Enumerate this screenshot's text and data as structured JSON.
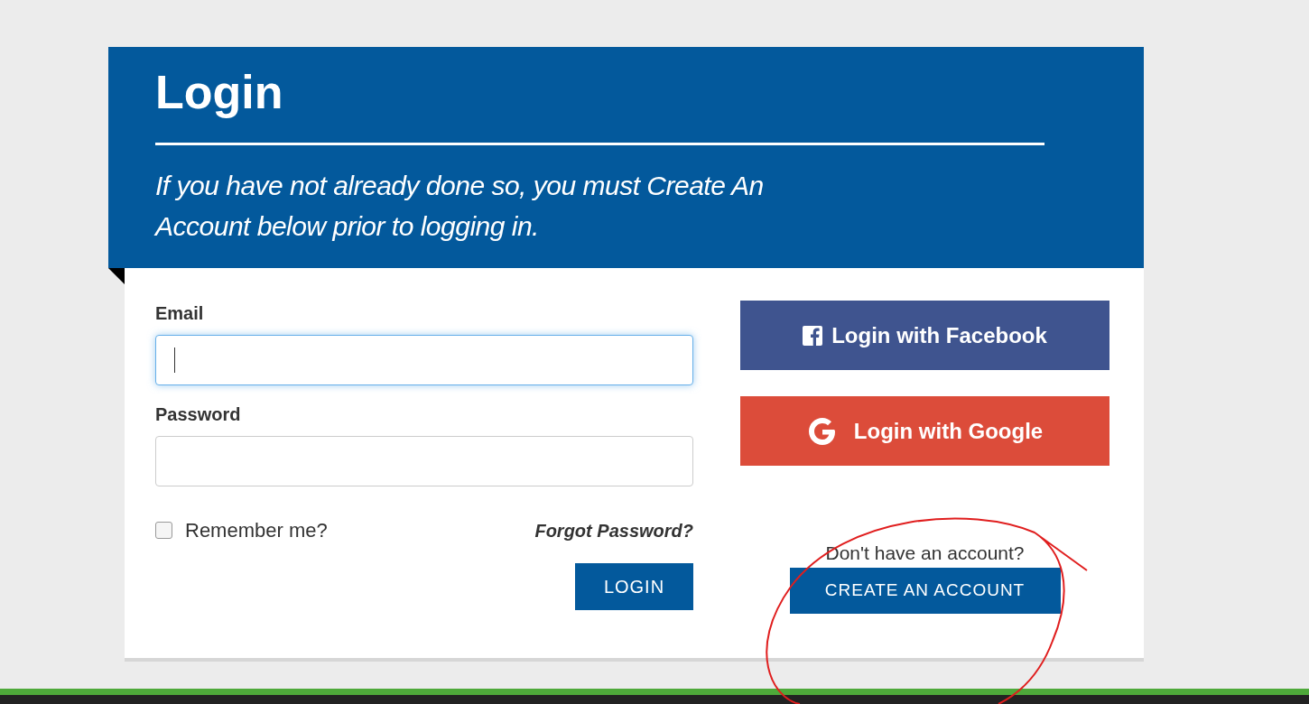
{
  "header": {
    "title": "Login",
    "subtitle": "If you have not already done so, you must Create An Account below prior to logging in."
  },
  "fields": [
    {
      "label": "Email",
      "focused": true
    },
    {
      "label": "Password",
      "focused": false
    }
  ],
  "remember": {
    "label": "Remember me?",
    "checked": false
  },
  "forgot_link": "Forgot Password?",
  "login_button": "LOGIN",
  "social_buttons": [
    {
      "kind": "facebook",
      "label": "Login with Facebook"
    },
    {
      "kind": "google",
      "label": "Login with Google"
    }
  ],
  "signup": {
    "prompt": "Don't have an account?",
    "button": "CREATE AN ACCOUNT"
  }
}
